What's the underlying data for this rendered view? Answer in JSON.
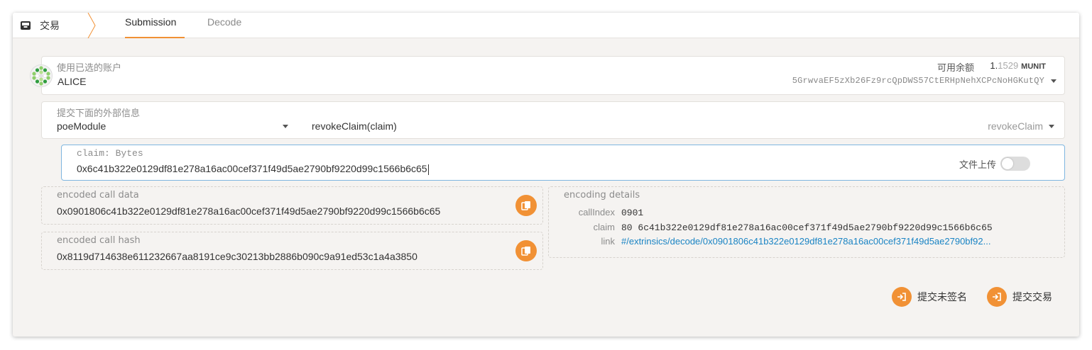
{
  "header": {
    "app_title": "交易",
    "tabs": [
      {
        "label": "Submission",
        "active": true
      },
      {
        "label": "Decode",
        "active": false
      }
    ]
  },
  "account": {
    "label": "使用已选的账户",
    "name": "ALICE",
    "balance_label": "可用余额",
    "balance_int": "1.",
    "balance_frac": "1529",
    "balance_unit": "MUNIT",
    "address": "5GrwvaEF5zXb26Fz9rcQpDWS57CtERHpNehXCPcNoHGKutQY"
  },
  "extrinsic": {
    "label": "提交下面的外部信息",
    "module": "poeModule",
    "call": "revokeClaim(claim)",
    "call_name": "revokeClaim"
  },
  "param": {
    "label": "claim: Bytes",
    "value": "0x6c41b322e0129df81e278a16ac00cef371f49d5ae2790bf9220d99c1566b6c65",
    "file_upload_label": "文件上传",
    "file_upload_on": false
  },
  "encoded": {
    "call_data_label": "encoded call data",
    "call_data": "0x0901806c41b322e0129df81e278a16ac00cef371f49d5ae2790bf9220d99c1566b6c65",
    "call_hash_label": "encoded call hash",
    "call_hash": "0x8119d714638e611232667aa8191ce9c30213bb2886b090c9a91ed53c1a4a3850"
  },
  "details": {
    "title": "encoding details",
    "call_index_key": "callIndex",
    "call_index_val": "0901",
    "claim_key": "claim",
    "claim_val": "80 6c41b322e0129df81e278a16ac00cef371f49d5ae2790bf9220d99c1566b6c65",
    "link_key": "link",
    "link_val": "#/extrinsics/decode/0x0901806c41b322e0129df81e278a16ac00cef371f49d5ae2790bf92..."
  },
  "actions": {
    "unsigned_label": "提交未签名",
    "submit_label": "提交交易"
  },
  "colors": {
    "accent": "#f19135",
    "link": "#1a84c4",
    "focus_border": "#7fb6e0"
  }
}
